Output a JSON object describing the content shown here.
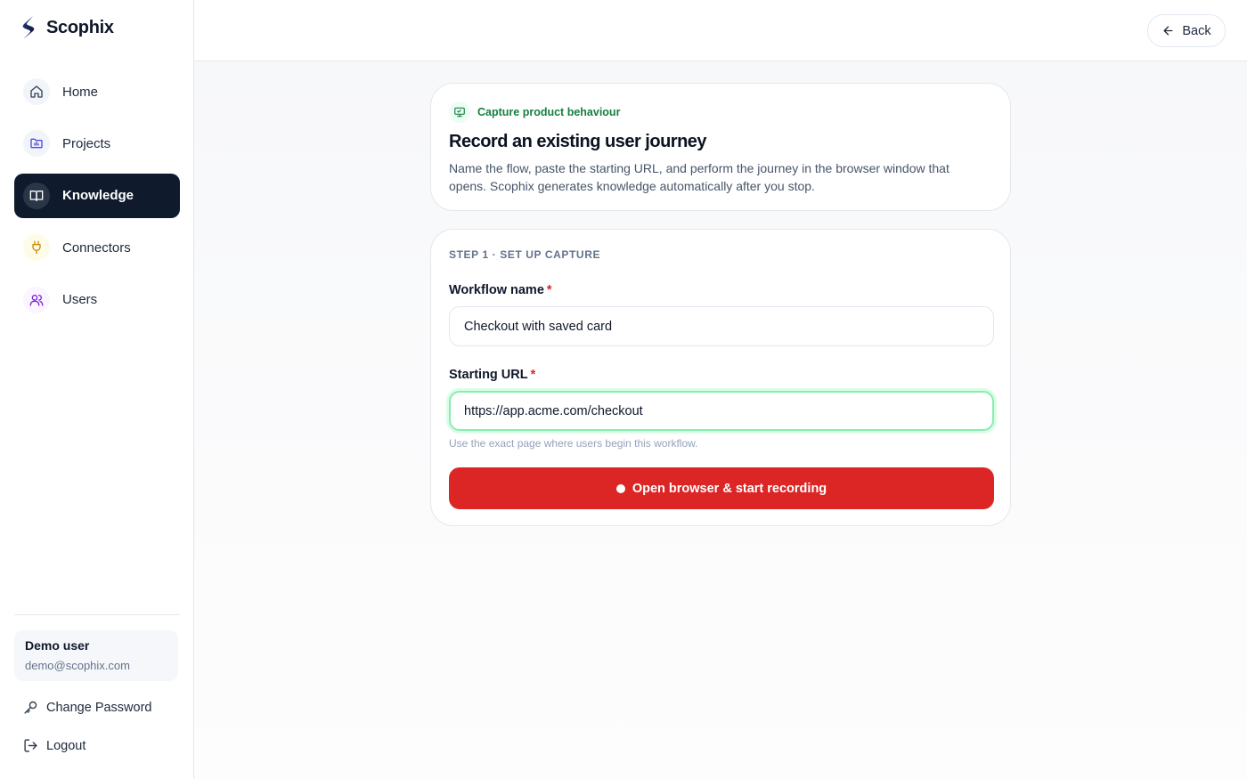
{
  "app": {
    "name": "Scophix"
  },
  "sidebar": {
    "items": [
      {
        "label": "Home",
        "icon": "home-icon",
        "active": false
      },
      {
        "label": "Projects",
        "icon": "folder-chart-icon",
        "active": false
      },
      {
        "label": "Knowledge",
        "icon": "book-open-icon",
        "active": true
      },
      {
        "label": "Connectors",
        "icon": "plug-icon",
        "active": false
      },
      {
        "label": "Users",
        "icon": "users-icon",
        "active": false
      }
    ],
    "user": {
      "name": "Demo user",
      "email": "demo@scophix.com"
    },
    "change_password_label": "Change Password",
    "logout_label": "Logout"
  },
  "topbar": {
    "back_label": "Back"
  },
  "intro": {
    "badge": "Capture product behaviour",
    "title": "Record an existing user journey",
    "description": "Name the flow, paste the starting URL, and perform the journey in the browser window that opens. Scophix generates knowledge automatically after you stop."
  },
  "form": {
    "step_label": "STEP 1 · SET UP CAPTURE",
    "workflow_name": {
      "label": "Workflow name",
      "required_mark": "*",
      "value": "Checkout with saved card"
    },
    "starting_url": {
      "label": "Starting URL",
      "required_mark": "*",
      "value": "https://app.acme.com/checkout",
      "hint": "Use the exact page where users begin this workflow."
    },
    "record_button_label": "Open browser & start recording"
  },
  "colors": {
    "sidebar_active_bg": "#0f1b2d",
    "record_button": "#dc2626",
    "badge_green": "#15803d",
    "focus_ring": "#86efac",
    "required": "#dc2626"
  }
}
